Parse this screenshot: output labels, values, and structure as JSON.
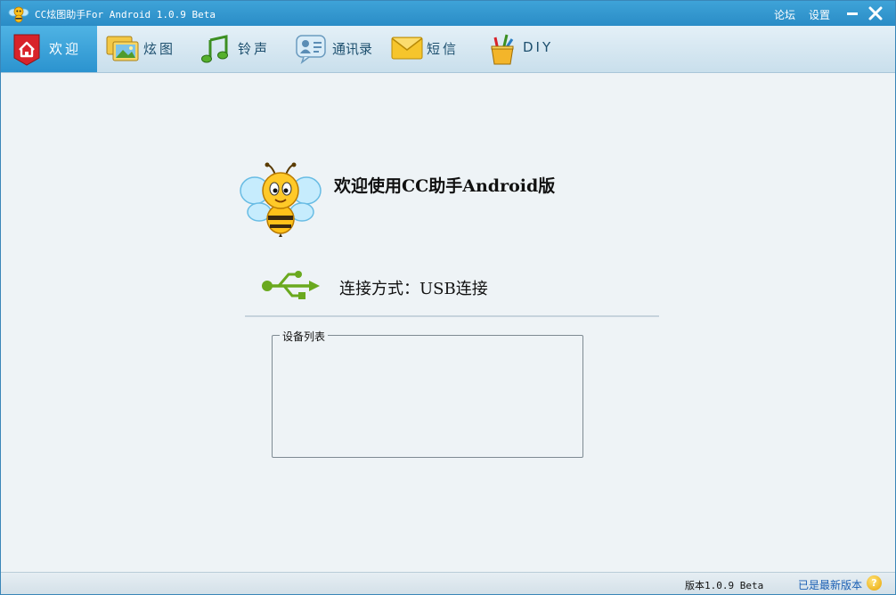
{
  "window": {
    "title": "CC炫图助手For Android 1.0.9 Beta",
    "links": {
      "forum": "论坛",
      "settings": "设置"
    }
  },
  "toolbar": {
    "tabs": [
      {
        "label": "欢迎",
        "icon": "home-icon",
        "active": true
      },
      {
        "label": "炫图",
        "icon": "picture-icon"
      },
      {
        "label": "铃声",
        "icon": "music-note-icon"
      },
      {
        "label": "通讯录",
        "icon": "contacts-icon"
      },
      {
        "label": "短信",
        "icon": "envelope-icon"
      },
      {
        "label": "DIY",
        "icon": "paint-bucket-icon"
      }
    ]
  },
  "main": {
    "welcome_text": "欢迎使用CC助手Android版",
    "connection_text": "连接方式：USB连接",
    "device_list_label": "设备列表"
  },
  "statusbar": {
    "version": "版本1.0.9 Beta",
    "latest": "已是最新版本",
    "help_glyph": "?"
  },
  "colors": {
    "titlebar": "#2a8cc6",
    "active_tab": "#2b93cf",
    "usb_green": "#6aa91e",
    "home_red": "#d8232a"
  }
}
